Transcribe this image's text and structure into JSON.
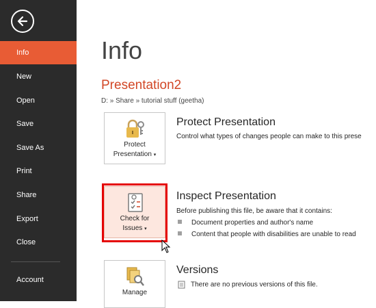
{
  "sidebar": {
    "items": [
      {
        "label": "Info",
        "active": true
      },
      {
        "label": "New"
      },
      {
        "label": "Open"
      },
      {
        "label": "Save"
      },
      {
        "label": "Save As"
      },
      {
        "label": "Print"
      },
      {
        "label": "Share"
      },
      {
        "label": "Export"
      },
      {
        "label": "Close"
      },
      {
        "label": "Account"
      }
    ],
    "back_icon": "back-arrow-icon",
    "active_color": "#e85c35"
  },
  "main": {
    "title": "Info",
    "document_name": "Presentation2",
    "document_path": "D: » Share » tutorial stuff (geetha)",
    "protect": {
      "tile_line1": "Protect",
      "tile_line2": "Presentation",
      "title": "Protect Presentation",
      "description": "Control what types of changes people can make to this prese",
      "icon": "lock-key-icon"
    },
    "inspect": {
      "tile_line1": "Check for",
      "tile_line2": "Issues",
      "title": "Inspect Presentation",
      "description": "Before publishing this file, be aware that it contains:",
      "bullets": [
        "Document properties and author's name",
        "Content that people with disabilities are unable to read"
      ],
      "icon": "checklist-icon",
      "highlight_color": "#e50000"
    },
    "versions": {
      "tile_line1": "Manage",
      "title": "Versions",
      "description": "There are no previous versions of this file.",
      "icon": "document-search-icon"
    }
  }
}
